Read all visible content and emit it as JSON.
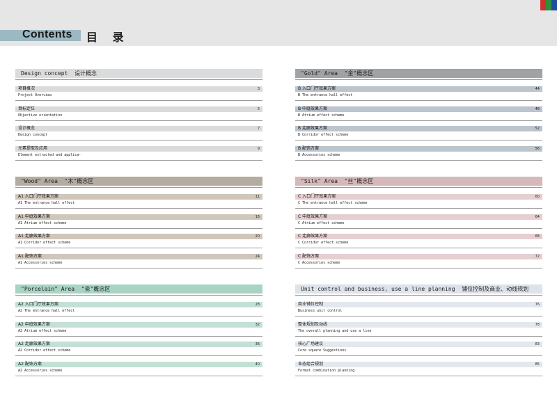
{
  "header": {
    "title_en": "Contents",
    "title_zh": "目 录",
    "flag_colors": [
      "#d32f2f",
      "#2f8f3a",
      "#1c4f9c"
    ]
  },
  "sections": [
    {
      "id": "design",
      "title": "Design concept  设计概念",
      "colors": {
        "head": "#dadbdc",
        "bar": "#dadbdc"
      },
      "entries": [
        {
          "title": "项目概况",
          "sub": "Project Overview",
          "page": "3"
        },
        {
          "title": "目标定位",
          "sub": "Objective orientation",
          "page": "5"
        },
        {
          "title": "设计概念",
          "sub": "Design concept",
          "page": "7"
        },
        {
          "title": "元素提取及应用",
          "sub": "Element extracted and applica-",
          "page": "9"
        }
      ]
    },
    {
      "id": "wood",
      "title": "\"Wood\" Area  \"木\"概念区",
      "colors": {
        "head": "#b4aca0",
        "bar": "#cfc7bb"
      },
      "entries": [
        {
          "title": "A1 入口门厅效果方案",
          "sub": "A1 The entrance hall effect",
          "page": "11"
        },
        {
          "title": "A1 中庭效果方案",
          "sub": "A1 Atrium effect scheme",
          "page": "16"
        },
        {
          "title": "A1 走廊效果方案",
          "sub": "A1 Corridor effect scheme",
          "page": "20"
        },
        {
          "title": "A1 配饰方案",
          "sub": "A1 Accessories scheme",
          "page": "24"
        }
      ]
    },
    {
      "id": "porcelain",
      "title": "\"Porcelain\" Area  \"瓷\"概念区",
      "colors": {
        "head": "#a9d4c3",
        "bar": "#c2e1d4"
      },
      "entries": [
        {
          "title": "A2 入口门厅效果方案",
          "sub": "A2 The entrance hall effect",
          "page": "28"
        },
        {
          "title": "A2 中庭效果方案",
          "sub": "A2 Atrium effect scheme",
          "page": "32"
        },
        {
          "title": "A2 走廊效果方案",
          "sub": "A2 Corridor effect scheme",
          "page": "36"
        },
        {
          "title": "A2 配饰方案",
          "sub": "A2 Accessories scheme",
          "page": "40"
        }
      ]
    },
    {
      "id": "gold",
      "title": "\"Gold\" Area  \"金\"概念区",
      "colors": {
        "head": "#9fa3a6",
        "bar": "#bcc4cc"
      },
      "entries": [
        {
          "title": "B 入口门厅效果方案",
          "sub": "B The entrance hall effect",
          "page": "44"
        },
        {
          "title": "B 中庭效果方案",
          "sub": "B Atrium effect scheme",
          "page": "48"
        },
        {
          "title": "B 走廊效果方案",
          "sub": "B Corridor effect scheme",
          "page": "52"
        },
        {
          "title": "B 配饰方案",
          "sub": "B Accessories scheme",
          "page": "56"
        }
      ]
    },
    {
      "id": "silk",
      "title": "\"Silk\" Area  \"丝\"概念区",
      "colors": {
        "head": "#d4b8ba",
        "bar": "#e5cfd0"
      },
      "entries": [
        {
          "title": "C 入口门厅效果方案",
          "sub": "C The entrance hall effect scheme",
          "page": "60"
        },
        {
          "title": "C 中庭效果方案",
          "sub": "C Atrium effect scheme",
          "page": "64"
        },
        {
          "title": "C 走廊效果方案",
          "sub": "C Corridor effect scheme",
          "page": "68"
        },
        {
          "title": "C 配饰方案",
          "sub": "C Accessories scheme",
          "page": "72"
        }
      ]
    },
    {
      "id": "unit",
      "title": "Unit control and business, use a line planning  铺位控制及商业、动线规划",
      "colors": {
        "head": "#dde3e8",
        "bar": "#e2e8ed"
      },
      "entries": [
        {
          "title": "商业铺位控制",
          "sub": "Business unit control",
          "page": "76"
        },
        {
          "title": "整体规划及动线",
          "sub": "The overall planning and use a line",
          "page": "78"
        },
        {
          "title": "核心广场建议",
          "sub": "Core square Suggestions",
          "page": "83"
        },
        {
          "title": "业态组合规划",
          "sub": "Format combination planning",
          "page": "85"
        }
      ]
    }
  ]
}
